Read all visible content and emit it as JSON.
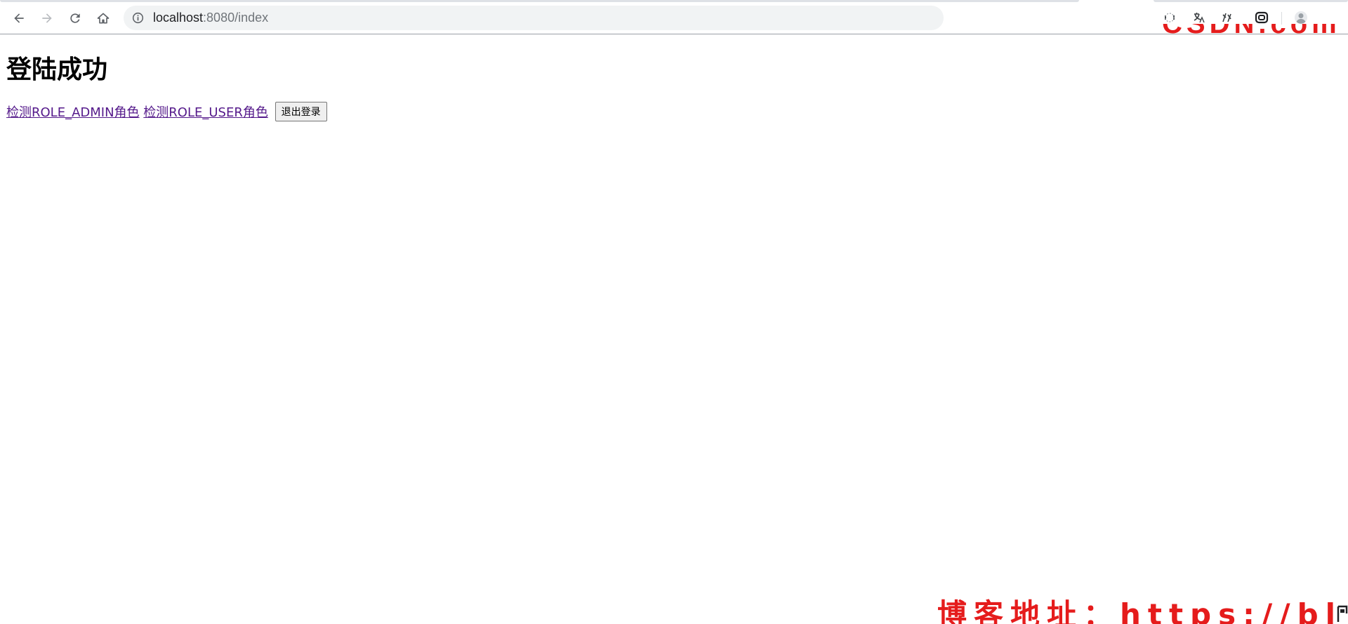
{
  "browser": {
    "url_host": "localhost",
    "url_rest": ":8080/index",
    "nav_icons": [
      "back-arrow-icon",
      "forward-arrow-icon",
      "reload-icon",
      "home-icon"
    ],
    "extension_icons": [
      "extension-icon",
      "translate-icon",
      "extension-icon",
      "extension-icon"
    ],
    "profile_icon": "avatar-icon",
    "watermark_text": "CSDN.com"
  },
  "page": {
    "title": "登陆成功",
    "links": [
      {
        "label": "检测ROLE_ADMIN角色"
      },
      {
        "label": "检测ROLE_USER角色"
      }
    ],
    "logout_button": "退出登录",
    "link_color": "#551a8b",
    "watermark_text": "博客地址：https://blog.csdn.net"
  },
  "colors": {
    "watermark": "#e51c1c",
    "address_bar_bg": "#f1f3f4"
  }
}
